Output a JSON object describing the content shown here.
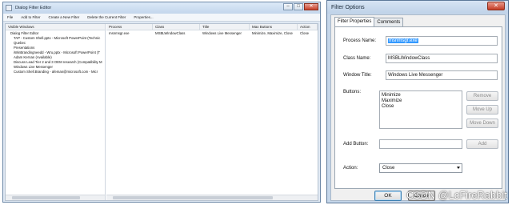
{
  "left_window": {
    "title": "Dialog Filter Editor",
    "menu": [
      "File",
      "Add to Filter",
      "Create a New Filter",
      "Delete the Current Filter",
      "Properties..."
    ],
    "tree_header": "Visible Windows",
    "tree_items": [
      "Dialog Filter Editor",
      "TAP - Custom Shell.pptx - Microsoft PowerPoint (Technic",
      "Quebec",
      "Presentations",
      "iWinBrandingneedd - Wru.pptx - Microsoft PowerPoint (T",
      "Adam Kernan (Available)",
      "Discuss Lead Tier 2 and 3 OEM research (Compatibility M",
      "Windows Live Messenger",
      "Custom Shell.Branding - afeman@microsoft.com - Micr"
    ],
    "grid_columns": [
      "Process",
      "Class",
      "Title",
      "Max Buttons",
      "Action"
    ],
    "grid_rows": [
      {
        "process": "msnmsgr.exe",
        "class": "MSBLWindowClass",
        "title": "Windows Live Messenger",
        "buttons": "Minimize, Maximize, Close",
        "action": "Close"
      }
    ]
  },
  "dialog": {
    "title": "Filter Options",
    "close_glyph": "✕",
    "tabs": [
      "Filter Properties",
      "Comments"
    ],
    "process_name_label": "Process Name:",
    "process_name_value": "msnmsgr.exe",
    "class_name_label": "Class Name:",
    "class_name_value": "MSBLWindowClass",
    "window_title_label": "Window Title:",
    "window_title_value": "Windows Live Messenger",
    "buttons_label": "Buttons:",
    "buttons_list": [
      "Minimize",
      "Maximize",
      "Close"
    ],
    "remove_label": "Remove",
    "move_up_label": "Move Up",
    "move_down_label": "Move Down",
    "add_button_label": "Add Button:",
    "add_button_value": "",
    "add_label": "Add",
    "action_label": "Action:",
    "action_value": "Close",
    "ok_label": "OK",
    "cancel_label": "Cancel"
  },
  "watermark": "CSDN @LcFireRabbit"
}
